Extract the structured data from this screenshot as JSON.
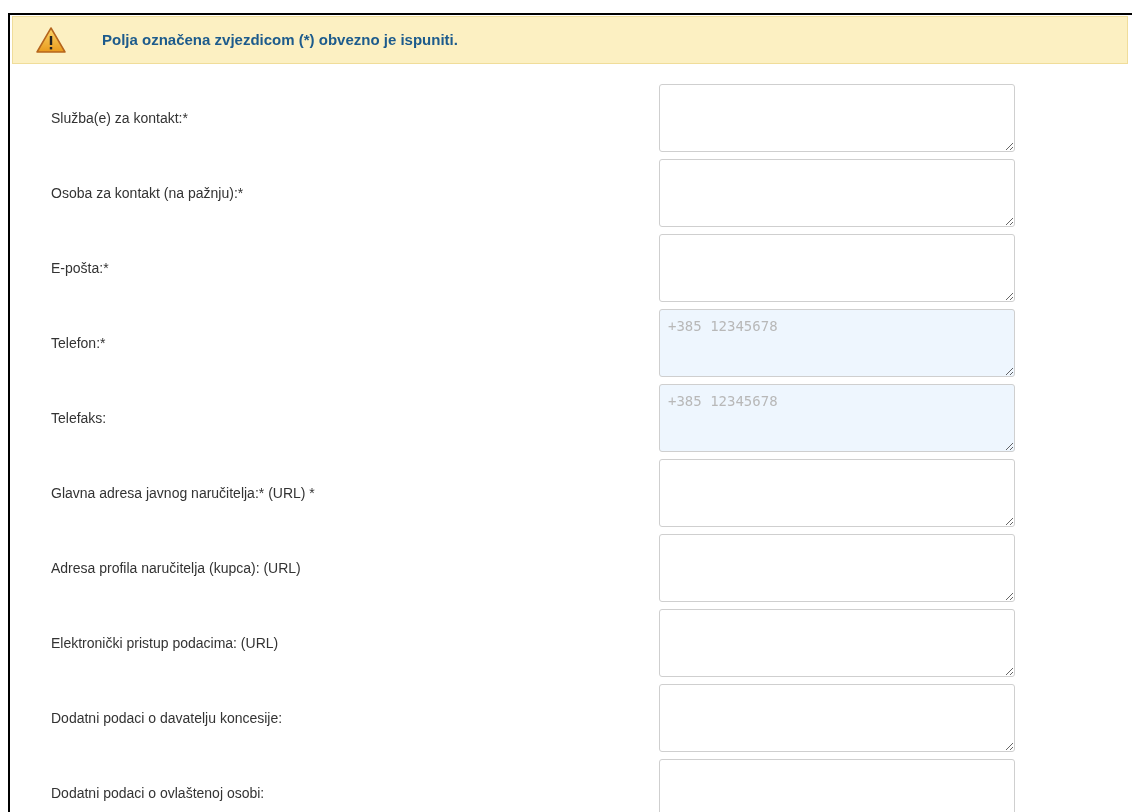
{
  "notice": {
    "text": "Polja označena zvjezdicom (*) obvezno je ispuniti."
  },
  "fields": [
    {
      "label": "Služba(e) za kontakt:*",
      "kind": "text"
    },
    {
      "label": "Osoba za kontakt (na pažnju):*",
      "kind": "text"
    },
    {
      "label": "E-pošta:*",
      "kind": "text"
    },
    {
      "label": "Telefon:*",
      "kind": "phone",
      "placeholder": "+385 12345678"
    },
    {
      "label": "Telefaks:",
      "kind": "phone",
      "placeholder": "+385 12345678"
    },
    {
      "label": "Glavna adresa javnog naručitelja:* (URL) *",
      "kind": "text"
    },
    {
      "label": "Adresa profila naručitelja (kupca): (URL)",
      "kind": "text"
    },
    {
      "label": "Elektronički pristup podacima: (URL)",
      "kind": "text"
    },
    {
      "label": "Dodatni podaci o davatelju koncesije:",
      "kind": "text"
    },
    {
      "label": "Dodatni podaci o ovlaštenoj osobi:",
      "kind": "text"
    }
  ]
}
